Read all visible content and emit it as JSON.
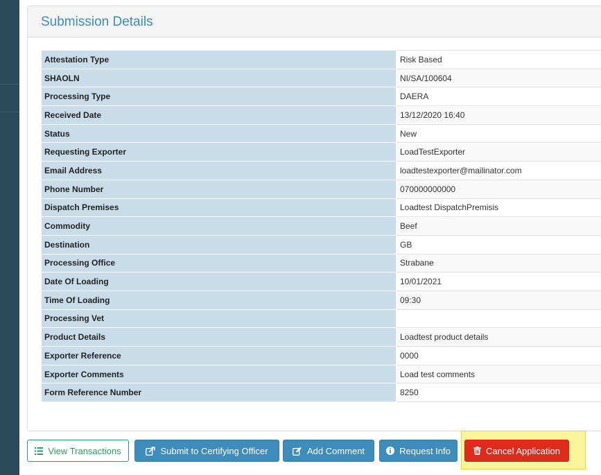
{
  "panel": {
    "title": "Submission Details"
  },
  "details": [
    {
      "label": "Attestation Type",
      "value": "Risk Based"
    },
    {
      "label": "SHAOLN",
      "value": "NI/SA/100604"
    },
    {
      "label": "Processing Type",
      "value": "DAERA"
    },
    {
      "label": "Received Date",
      "value": "13/12/2020 16:40"
    },
    {
      "label": "Status",
      "value": "New"
    },
    {
      "label": "Requesting Exporter",
      "value": "LoadTestExporter"
    },
    {
      "label": "Email Address",
      "value": "loadtestexporter@mailinator.com"
    },
    {
      "label": "Phone Number",
      "value": "070000000000"
    },
    {
      "label": "Dispatch Premises",
      "value": "Loadtest DispatchPremisis"
    },
    {
      "label": "Commodity",
      "value": "Beef"
    },
    {
      "label": "Destination",
      "value": "GB"
    },
    {
      "label": "Processing Office",
      "value": "Strabane"
    },
    {
      "label": "Date Of Loading",
      "value": "10/01/2021"
    },
    {
      "label": "Time Of Loading",
      "value": "09:30"
    },
    {
      "label": "Processing Vet",
      "value": ""
    },
    {
      "label": "Product Details",
      "value": "Loadtest  product details"
    },
    {
      "label": "Exporter Reference",
      "value": "0000"
    },
    {
      "label": "Exporter Comments",
      "value": "Load test comments"
    },
    {
      "label": "Form Reference Number",
      "value": "8250"
    }
  ],
  "actions": {
    "view_transactions": "View Transactions",
    "submit_certifying": "Submit to Certifying Officer",
    "add_comment": "Add Comment",
    "request_info": "Request Info",
    "cancel_application": "Cancel Application"
  },
  "icons": {
    "view_transactions": "list-icon",
    "submit_certifying": "share-icon",
    "add_comment": "edit-icon",
    "request_info": "info-circle-icon",
    "cancel_application": "trash-icon"
  },
  "colors": {
    "sidebar": "#2c4a5a",
    "title": "#3c8dbc",
    "label_cell": "#c8dde9",
    "outline_green": "#2e9e5b",
    "primary_blue": "#3c8dbc",
    "danger_red": "#dd2c1b",
    "highlight_yellow": "#fbf59a"
  }
}
